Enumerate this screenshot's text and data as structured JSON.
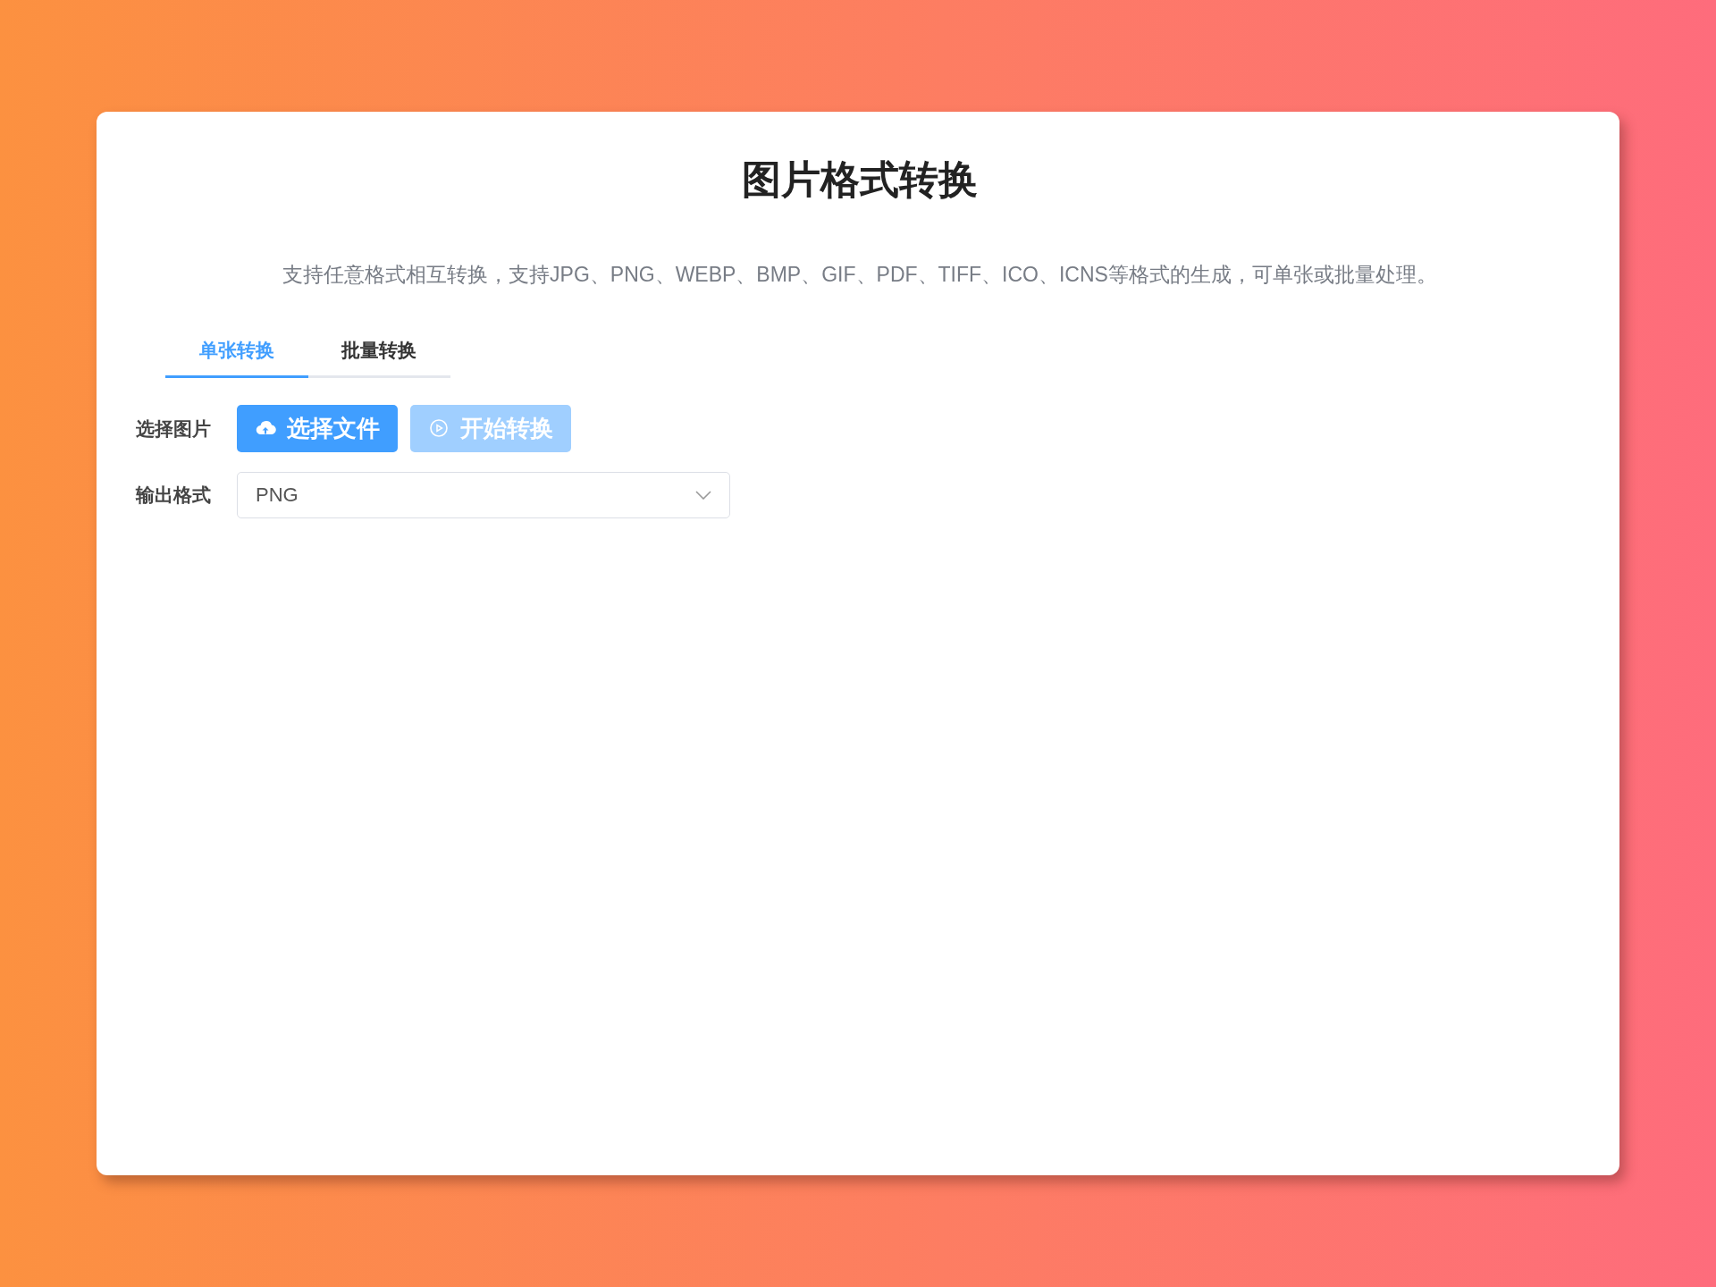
{
  "title": "图片格式转换",
  "description": "支持任意格式相互转换，支持JPG、PNG、WEBP、BMP、GIF、PDF、TIFF、ICO、ICNS等格式的生成，可单张或批量处理。",
  "tabs": [
    {
      "label": "单张转换",
      "selected": true
    },
    {
      "label": "批量转换",
      "selected": false
    }
  ],
  "form": {
    "file_label": "选择图片",
    "buttons": [
      {
        "label": "选择文件",
        "kind": "upload",
        "disabled": false
      },
      {
        "label": "开始转换",
        "kind": "start",
        "disabled": true
      }
    ],
    "format_label": "输出格式",
    "format_value": "PNG"
  }
}
